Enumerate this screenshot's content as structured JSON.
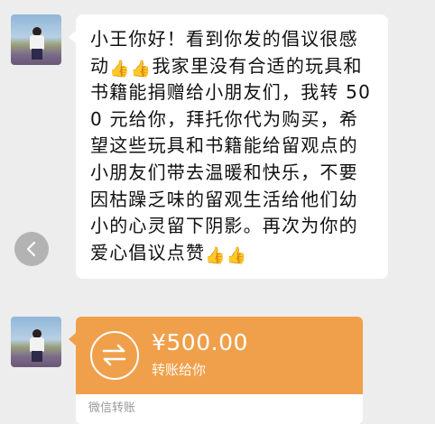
{
  "message": {
    "line1": "小王你好！看到你发的倡议很",
    "line2_prefix": "感动",
    "thumb1": "👍",
    "thumb2": "👍",
    "line2_suffix": "我家里没有合适的玩",
    "rest": "具和书籍能捐赠给小朋友们，我转 500 元给你，拜托你代为购买，希望这些玩具和书籍能给留观点的小朋友们带去温暖和快乐，不要因枯躁乏味的留观生活给他们幼小的心灵留下阴影。再次为你的爱心倡议点",
    "last_word": "赞",
    "thumb3": "👍",
    "thumb4": "👍"
  },
  "transfer": {
    "amount": "¥500.00",
    "subtitle": "转账给你",
    "footer": "微信转账",
    "accent_color": "#f0a04b"
  },
  "icons": {
    "back": "chevron-left-icon",
    "transfer": "transfer-arrows-icon"
  }
}
